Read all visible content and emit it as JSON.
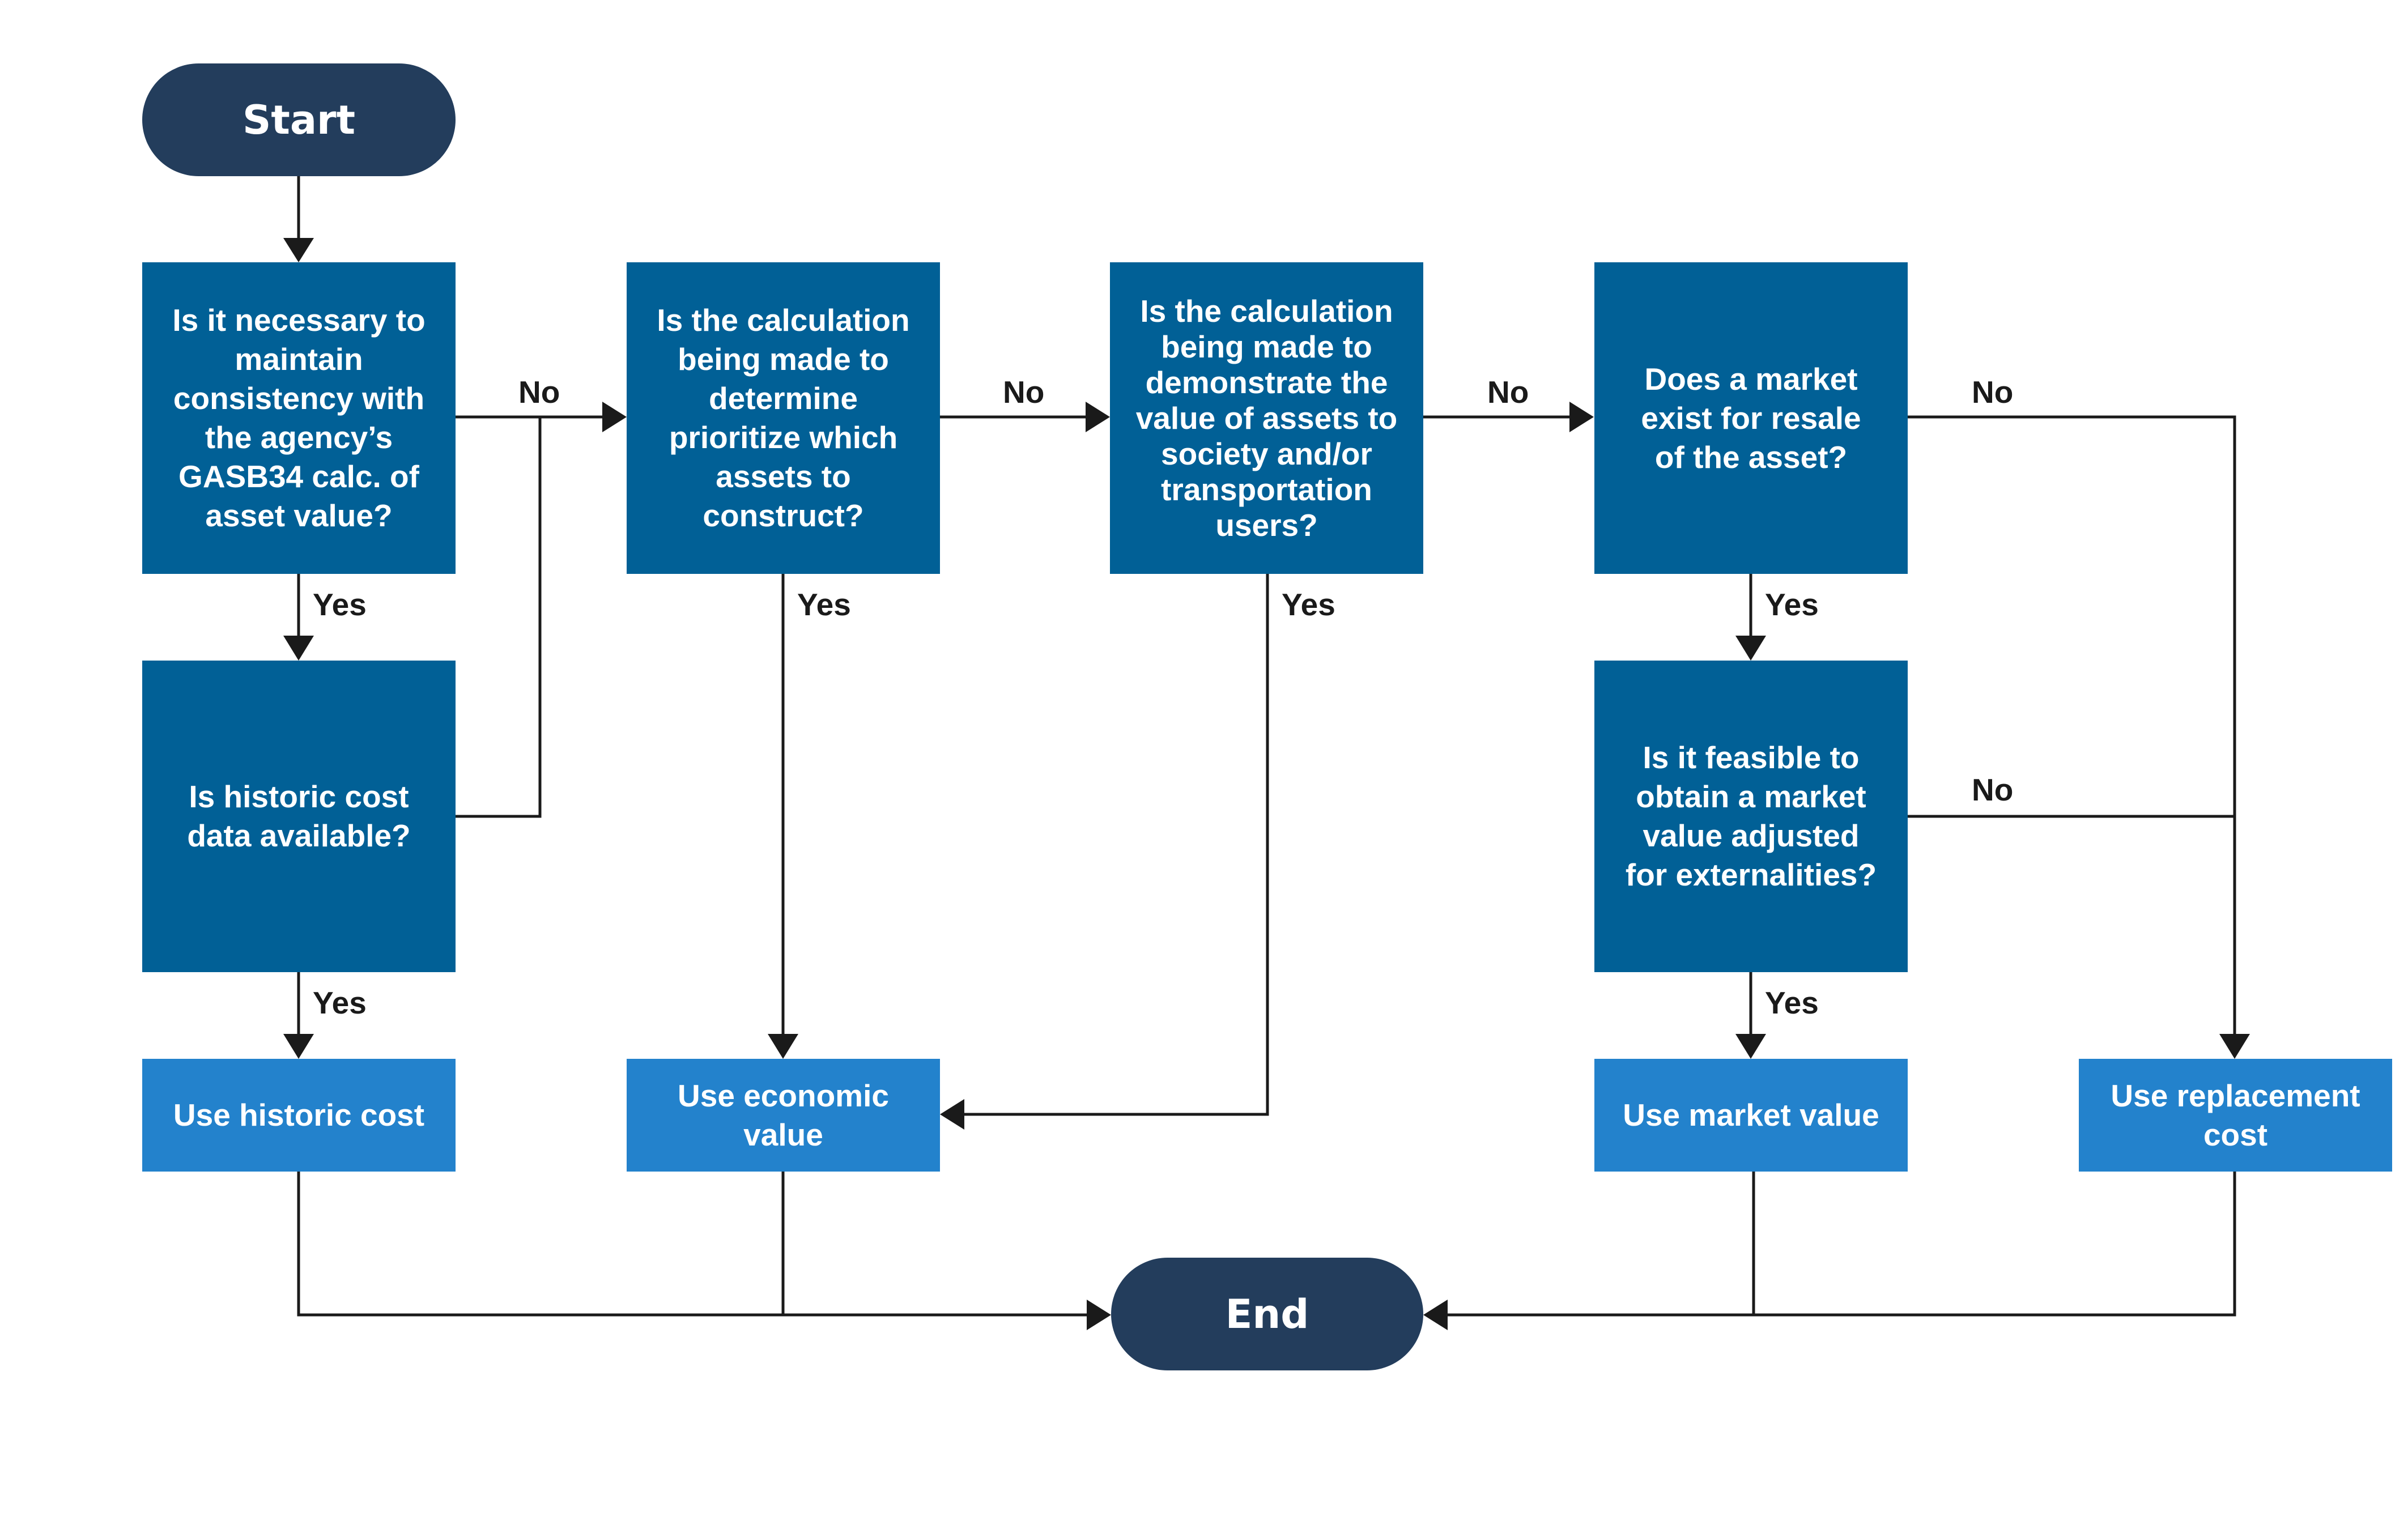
{
  "nodes": {
    "start": "Start",
    "end": "End",
    "q_gasb34": "Is it necessary to maintain consistency with the agency’s GASB34 calc. of asset value?",
    "q_historic_data": "Is historic cost data available?",
    "q_prioritize": "Is the calculation being made to determine prioritize which assets to construct?",
    "q_demonstrate": "Is the calculation being made to demonstrate the value of assets to society and/or transportation users?",
    "q_market_exists": "Does a market exist for resale of the asset?",
    "q_market_adjusted": "Is it feasible to obtain a market value adjusted for externalities?",
    "r_historic": "Use historic cost",
    "r_economic": "Use economic value",
    "r_market": "Use market value",
    "r_replacement": "Use replacement cost"
  },
  "edge_labels": {
    "yes": "Yes",
    "no": "No"
  },
  "colors": {
    "terminal": "#233d5c",
    "decision": "#016096",
    "result": "#2382cc",
    "connector": "#1a1a1a"
  }
}
